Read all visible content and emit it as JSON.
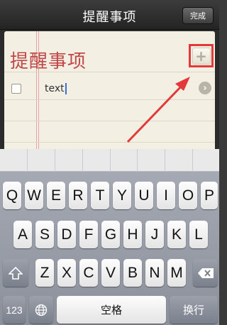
{
  "navbar": {
    "title": "提醒事项",
    "done_label": "完成"
  },
  "list": {
    "title": "提醒事项",
    "add_icon": "+",
    "items": [
      {
        "text": "text",
        "completed": false
      }
    ]
  },
  "keyboard": {
    "row1": [
      "Q",
      "W",
      "E",
      "R",
      "T",
      "Y",
      "U",
      "I",
      "O",
      "P"
    ],
    "row2": [
      "A",
      "S",
      "D",
      "F",
      "G",
      "H",
      "J",
      "K",
      "L"
    ],
    "row3": [
      "Z",
      "X",
      "C",
      "V",
      "B",
      "N",
      "M"
    ],
    "numbers_label": "123",
    "space_label": "空格",
    "return_label": "换行"
  },
  "colors": {
    "annotation": "#e23a3a",
    "list_title": "#c04848"
  }
}
